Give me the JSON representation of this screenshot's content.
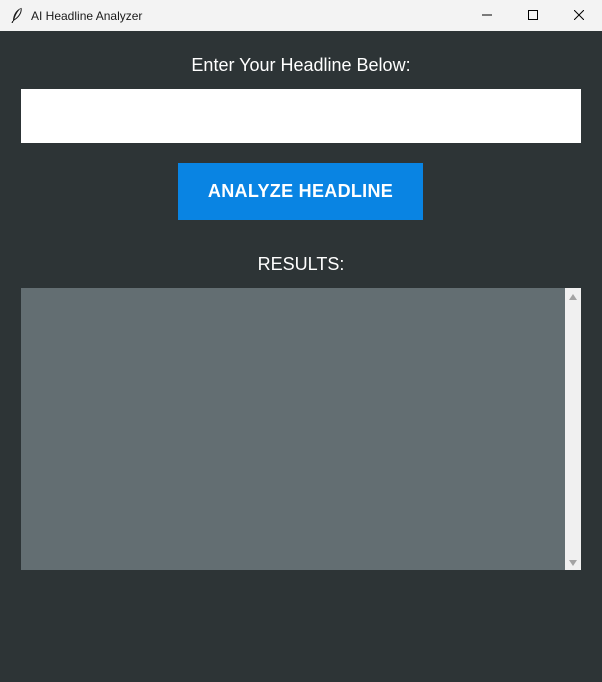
{
  "window": {
    "title": "AI Headline Analyzer",
    "minimize_icon": "minimize-icon",
    "maximize_icon": "maximize-icon",
    "close_icon": "close-icon",
    "app_icon": "feather-icon"
  },
  "input_section": {
    "label": "Enter Your Headline Below:",
    "value": "",
    "placeholder": ""
  },
  "actions": {
    "analyze_label": "ANALYZE HEADLINE"
  },
  "results": {
    "label": "RESULTS:",
    "text": ""
  },
  "colors": {
    "background": "#2d3436",
    "button": "#0984e3",
    "results_bg": "#636e72",
    "text": "#ffffff"
  }
}
